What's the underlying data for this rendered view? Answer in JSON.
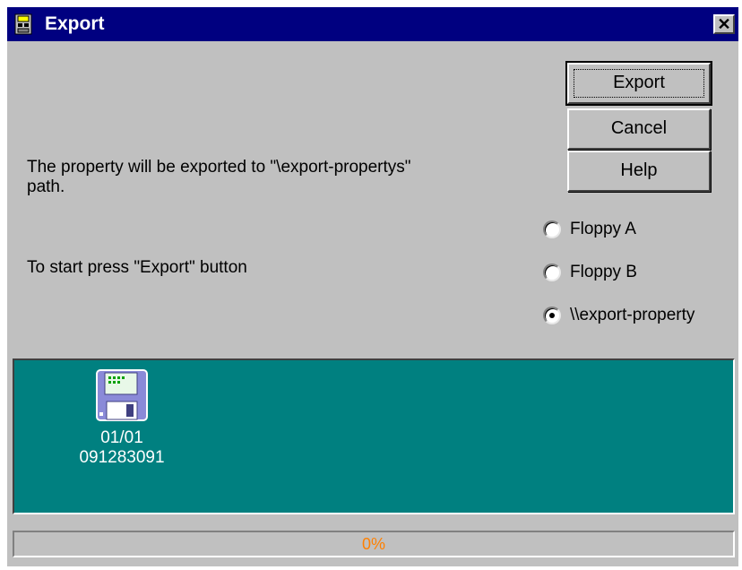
{
  "window": {
    "title": "Export",
    "close_glyph": "✕"
  },
  "buttons": {
    "export": "Export",
    "cancel": "Cancel",
    "help": "Help"
  },
  "message": {
    "line1": "The property will be exported to \"\\export-propertys\"",
    "line2": "path.",
    "start": "To start press \"Export\" button"
  },
  "destinations": [
    {
      "label": "Floppy A",
      "selected": false
    },
    {
      "label": "Floppy B",
      "selected": false
    },
    {
      "label": "\\\\export-property",
      "selected": true
    }
  ],
  "items": [
    {
      "icon": "floppy-disk-icon",
      "date": "01/01",
      "id": "091283091"
    }
  ],
  "progress": {
    "value": 0,
    "label": "0%"
  },
  "colors": {
    "titlebar": "#000080",
    "panel": "#008080",
    "progress_text": "#ff8000"
  }
}
